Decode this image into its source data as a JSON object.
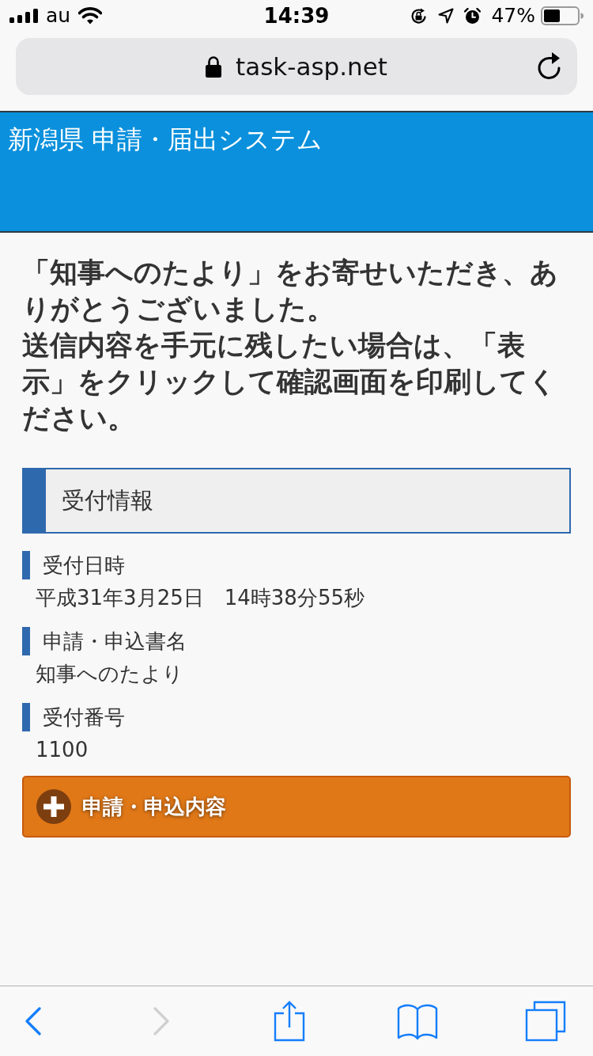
{
  "status_bar": {
    "carrier": "au",
    "time": "14:39",
    "battery_percent": "47%"
  },
  "address_bar": {
    "url": "task-asp.net"
  },
  "header": {
    "title": "新潟県 申請・届出システム"
  },
  "message": [
    "「知事へのたより」をお寄せいただき、ありがとうございました。",
    "送信内容を手元に残したい場合は、「表示」をクリックして確認画面を印刷してください。"
  ],
  "section": {
    "title": "受付情報",
    "fields": [
      {
        "label": "受付日時",
        "value": "平成31年3月25日　14時38分55秒"
      },
      {
        "label": "申請・申込書名",
        "value": "知事へのたより"
      },
      {
        "label": "受付番号",
        "value": "1100"
      }
    ]
  },
  "expand_button": {
    "label": "申請・申込内容",
    "expanded": false
  },
  "toolbar": {
    "items": [
      {
        "kind": "back",
        "disabled": false
      },
      {
        "kind": "forward",
        "disabled": true
      },
      {
        "kind": "share",
        "disabled": false
      },
      {
        "kind": "bookmarks",
        "disabled": false
      },
      {
        "kind": "tabs",
        "disabled": false
      }
    ]
  }
}
